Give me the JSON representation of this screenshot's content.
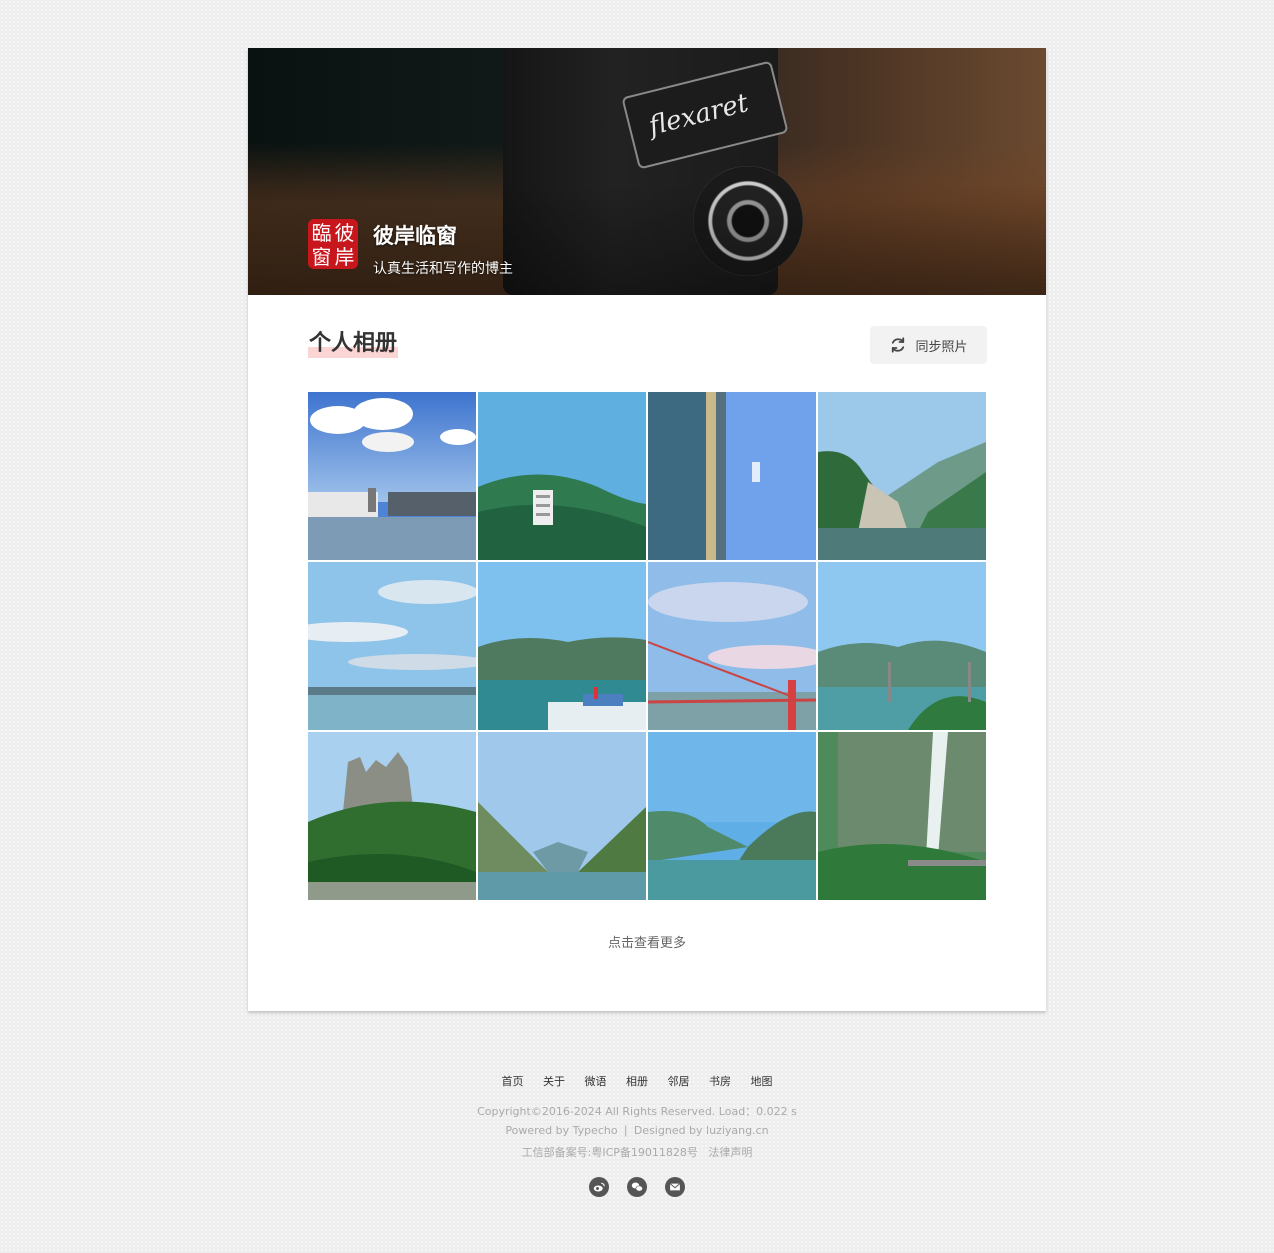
{
  "site": {
    "logo_chars": [
      "臨",
      "彼",
      "窗",
      "岸"
    ],
    "title": "彼岸临窗",
    "subtitle": "认真生活和写作的博主",
    "banner_brand": "flexaret"
  },
  "page": {
    "title": "个人相册",
    "sync_label": "同步照片",
    "more_label": "点击查看更多"
  },
  "photos": [
    {
      "subject": "city-lake-clouds"
    },
    {
      "subject": "building-on-green-hill"
    },
    {
      "subject": "river-shore-vertical"
    },
    {
      "subject": "gorge-cliff-river"
    },
    {
      "subject": "sky-river-wide"
    },
    {
      "subject": "river-boats-mountains"
    },
    {
      "subject": "red-suspension-bridge"
    },
    {
      "subject": "bridge-green-mountains"
    },
    {
      "subject": "rock-peaks-forest"
    },
    {
      "subject": "gorge-river-valley"
    },
    {
      "subject": "mountain-river-wide"
    },
    {
      "subject": "waterfall-cliff"
    }
  ],
  "footer": {
    "nav": [
      "首页",
      "关于",
      "微语",
      "相册",
      "邻居",
      "书房",
      "地图"
    ],
    "copyright": "Copyright©2016-2024 All Rights Reserved. Load：0.022 s",
    "powered": "Powered by Typecho ❘ Designed by luziyang.cn",
    "icp": "工信部备案号:粤ICP备19011828号   法律声明",
    "social": [
      "weibo-icon",
      "wechat-icon",
      "mail-icon"
    ]
  }
}
